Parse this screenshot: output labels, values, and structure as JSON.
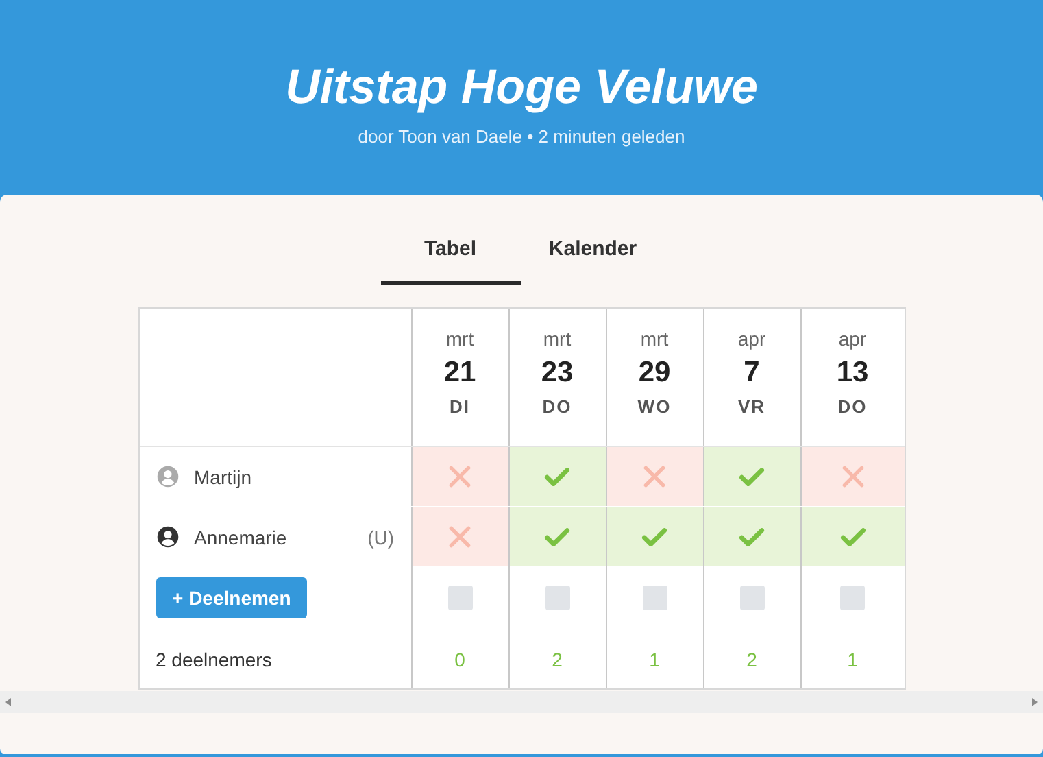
{
  "header": {
    "title": "Uitstap Hoge Veluwe",
    "subtitle": "door Toon van Daele • 2 minuten geleden"
  },
  "tabs": [
    {
      "label": "Tabel",
      "selected": true
    },
    {
      "label": "Kalender",
      "selected": false
    }
  ],
  "dates": [
    {
      "month": "mrt",
      "day": "21",
      "weekday": "DI"
    },
    {
      "month": "mrt",
      "day": "23",
      "weekday": "DO"
    },
    {
      "month": "mrt",
      "day": "29",
      "weekday": "WO"
    },
    {
      "month": "apr",
      "day": "7",
      "weekday": "VR"
    },
    {
      "month": "apr",
      "day": "13",
      "weekday": "DO"
    }
  ],
  "participants": [
    {
      "name": "Martijn",
      "current": false,
      "votes": [
        {
          "available": false
        },
        {
          "available": true
        },
        {
          "available": false
        },
        {
          "available": true
        },
        {
          "available": false
        }
      ]
    },
    {
      "name": "Annemarie",
      "current": true,
      "you_label": "(U)",
      "votes": [
        {
          "available": false
        },
        {
          "available": true
        },
        {
          "available": true
        },
        {
          "available": true
        },
        {
          "available": true
        }
      ]
    }
  ],
  "join_button": "+ Deelnemen",
  "join_checks": [
    {
      "checked": false
    },
    {
      "checked": false
    },
    {
      "checked": false
    },
    {
      "checked": false
    },
    {
      "checked": false
    }
  ],
  "footer": {
    "label": "2 deelnemers",
    "counts": [
      "0",
      "2",
      "1",
      "2",
      "1"
    ]
  }
}
